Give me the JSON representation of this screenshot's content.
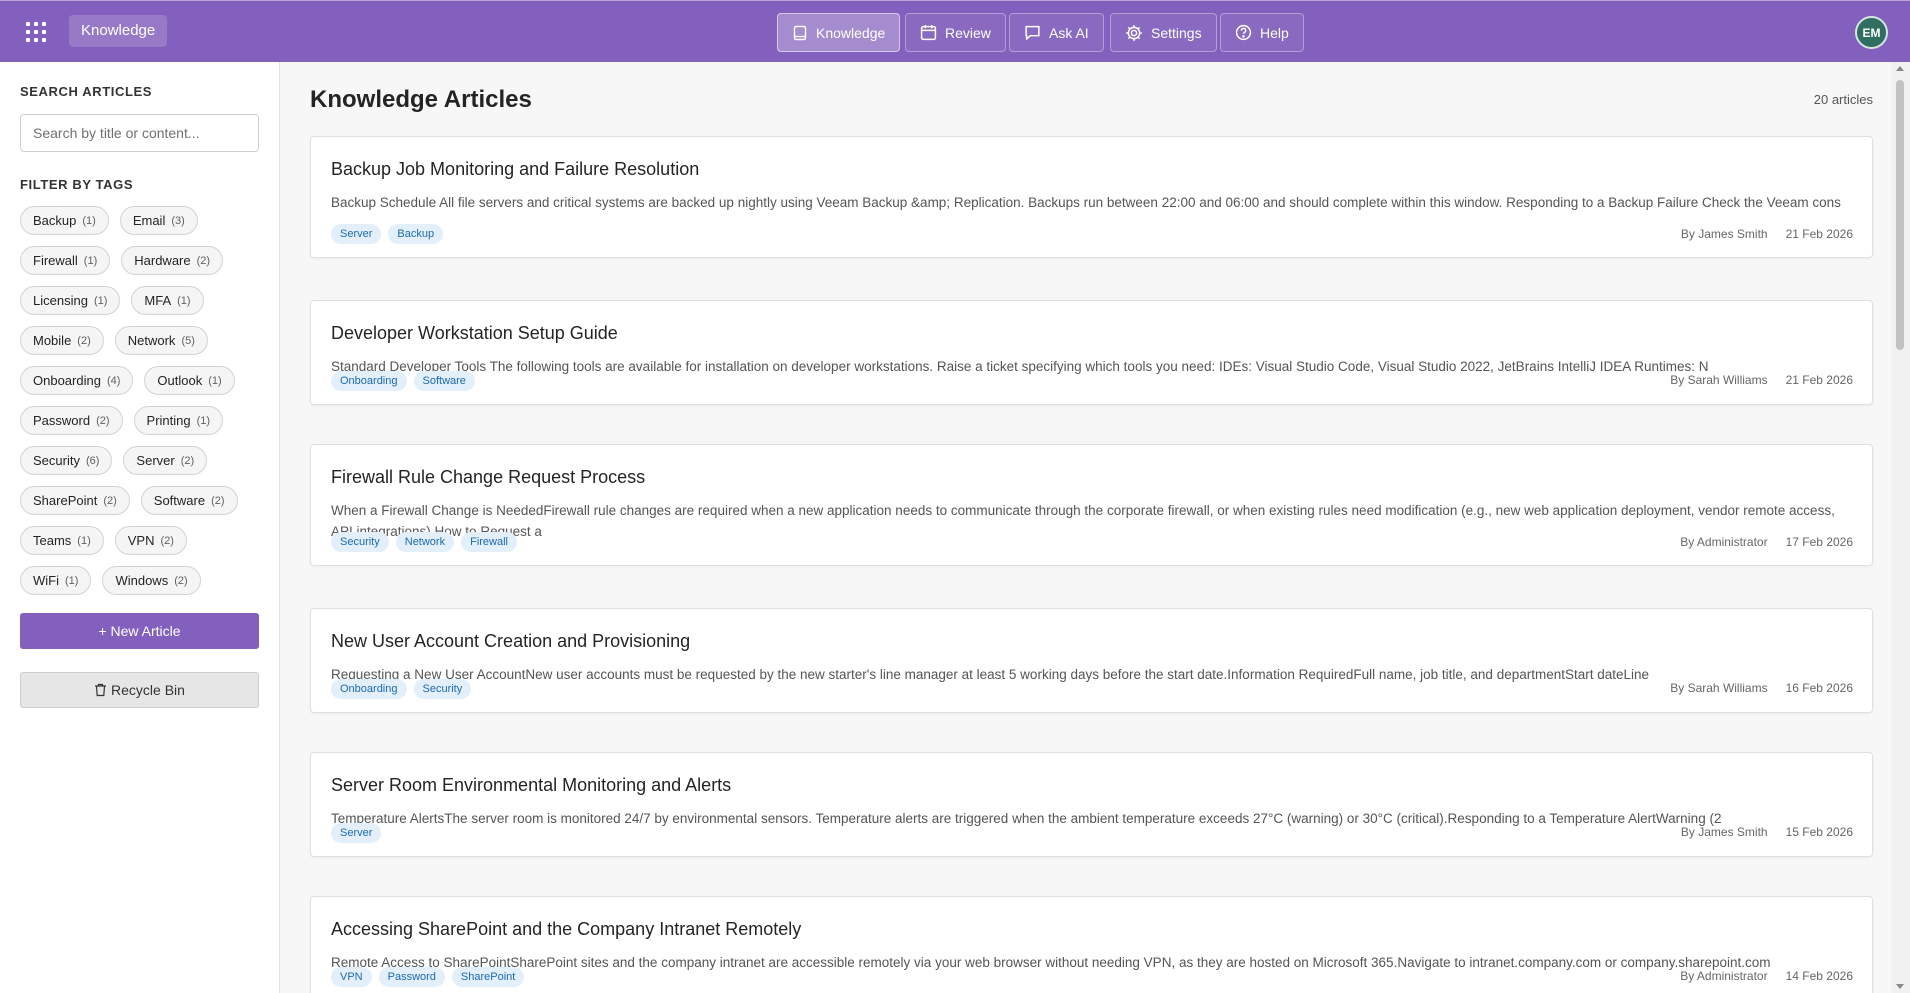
{
  "app": {
    "title": "Knowledge"
  },
  "nav": [
    {
      "label": "Knowledge",
      "icon": "book-icon",
      "active": true
    },
    {
      "label": "Review",
      "icon": "calendar-icon",
      "active": false
    },
    {
      "label": "Ask AI",
      "icon": "chat-icon",
      "active": false
    },
    {
      "label": "Settings",
      "icon": "gear-icon",
      "active": false
    },
    {
      "label": "Help",
      "icon": "help-circle-icon",
      "active": false
    }
  ],
  "user": {
    "initials": "EM"
  },
  "sidebar": {
    "search_heading": "SEARCH ARTICLES",
    "search_placeholder": "Search by title or content...",
    "filter_heading": "FILTER BY TAGS",
    "tags": [
      {
        "name": "Backup",
        "count": "(1)"
      },
      {
        "name": "Email",
        "count": "(3)"
      },
      {
        "name": "Firewall",
        "count": "(1)"
      },
      {
        "name": "Hardware",
        "count": "(2)"
      },
      {
        "name": "Licensing",
        "count": "(1)"
      },
      {
        "name": "MFA",
        "count": "(1)"
      },
      {
        "name": "Mobile",
        "count": "(2)"
      },
      {
        "name": "Network",
        "count": "(5)"
      },
      {
        "name": "Onboarding",
        "count": "(4)"
      },
      {
        "name": "Outlook",
        "count": "(1)"
      },
      {
        "name": "Password",
        "count": "(2)"
      },
      {
        "name": "Printing",
        "count": "(1)"
      },
      {
        "name": "Security",
        "count": "(6)"
      },
      {
        "name": "Server",
        "count": "(2)"
      },
      {
        "name": "SharePoint",
        "count": "(2)"
      },
      {
        "name": "Software",
        "count": "(2)"
      },
      {
        "name": "Teams",
        "count": "(1)"
      },
      {
        "name": "VPN",
        "count": "(2)"
      },
      {
        "name": "WiFi",
        "count": "(1)"
      },
      {
        "name": "Windows",
        "count": "(2)"
      }
    ],
    "new_article_label": "+ New Article",
    "recycle_bin_label": "Recycle Bin"
  },
  "main": {
    "title": "Knowledge Articles",
    "count_label": "20 articles",
    "articles": [
      {
        "title": "Backup Job Monitoring and Failure Resolution",
        "excerpt": "Backup Schedule All file servers and critical systems are backed up nightly using Veeam Backup &amp; Replication. Backups run between 22:00 and 06:00 and should complete within this window. Responding to a Backup Failure Check the Veeam cons",
        "tags": [
          "Server",
          "Backup"
        ],
        "author": "By James Smith",
        "date": "21 Feb 2026"
      },
      {
        "title": "Developer Workstation Setup Guide",
        "excerpt": "Standard Developer Tools The following tools are available for installation on developer workstations. Raise a ticket specifying which tools you need: IDEs: Visual Studio Code, Visual Studio 2022, JetBrains IntelliJ IDEA Runtimes: N",
        "tags": [
          "Onboarding",
          "Software"
        ],
        "author": "By Sarah Williams",
        "date": "21 Feb 2026"
      },
      {
        "title": "Firewall Rule Change Request Process",
        "excerpt": "When a Firewall Change is NeededFirewall rule changes are required when a new application needs to communicate through the corporate firewall, or when existing rules need modification (e.g., new web application deployment, vendor remote access, API integrations).How to Request a",
        "tags": [
          "Security",
          "Network",
          "Firewall"
        ],
        "author": "By Administrator",
        "date": "17 Feb 2026"
      },
      {
        "title": "New User Account Creation and Provisioning",
        "excerpt": "Requesting a New User AccountNew user accounts must be requested by the new starter's line manager at least 5 working days before the start date.Information RequiredFull name, job title, and departmentStart dateLine",
        "tags": [
          "Onboarding",
          "Security"
        ],
        "author": "By Sarah Williams",
        "date": "16 Feb 2026"
      },
      {
        "title": "Server Room Environmental Monitoring and Alerts",
        "excerpt": "Temperature AlertsThe server room is monitored 24/7 by environmental sensors. Temperature alerts are triggered when the ambient temperature exceeds 27°C (warning) or 30°C (critical).Responding to a Temperature AlertWarning (2",
        "tags": [
          "Server"
        ],
        "author": "By James Smith",
        "date": "15 Feb 2026"
      },
      {
        "title": "Accessing SharePoint and the Company Intranet Remotely",
        "excerpt": "Remote Access to SharePointSharePoint sites and the company intranet are accessible remotely via your web browser without needing VPN, as they are hosted on Microsoft 365.Navigate to intranet.company.com or company.sharepoint.com",
        "tags": [
          "VPN",
          "Password",
          "SharePoint"
        ],
        "author": "By Administrator",
        "date": "14 Feb 2026"
      }
    ]
  }
}
